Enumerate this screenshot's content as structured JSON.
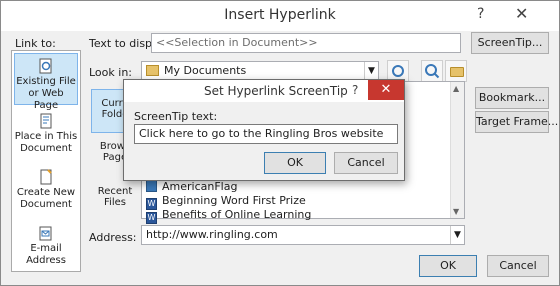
{
  "window": {
    "title": "Insert Hyperlink",
    "help_glyph": "?",
    "close_glyph": "✕"
  },
  "link_to": {
    "label": "Link to:",
    "items": [
      {
        "line1": "Existing File",
        "line2": "or Web Page"
      },
      {
        "line1": "Place in This",
        "line2": "Document"
      },
      {
        "line1": "Create New",
        "line2": "Document"
      },
      {
        "line1": "E-mail",
        "line2": "Address"
      }
    ]
  },
  "text_to_display": {
    "label": "Text to display:",
    "value": "<<Selection in Document>>"
  },
  "screentip_button": "ScreenTip...",
  "look_in": {
    "label": "Look in:",
    "value": "My Documents"
  },
  "side_buttons": {
    "bookmark": "Bookmark...",
    "target_frame": "Target Frame..."
  },
  "subnav": {
    "current_folder": [
      "Curre",
      "Folde"
    ],
    "browsed_pages": [
      "Brows",
      "Page"
    ],
    "recent_files": [
      "Recent",
      "Files"
    ]
  },
  "files": [
    "AmericanFlag",
    "Beginning Word First Prize",
    "Benefits of Online Learning"
  ],
  "address": {
    "label": "Address:",
    "value": "http://www.ringling.com"
  },
  "buttons": {
    "ok": "OK",
    "cancel": "Cancel"
  },
  "screentip_dialog": {
    "title": "Set Hyperlink ScreenTip",
    "help_glyph": "?",
    "close_glyph": "✕",
    "label": "ScreenTip text:",
    "value": "Click here to go to the Ringling Bros website",
    "ok": "OK",
    "cancel": "Cancel"
  },
  "colors": {
    "selection": "#cde6f7",
    "close_red": "#c7372f",
    "accent_border": "#3c7fb1"
  }
}
